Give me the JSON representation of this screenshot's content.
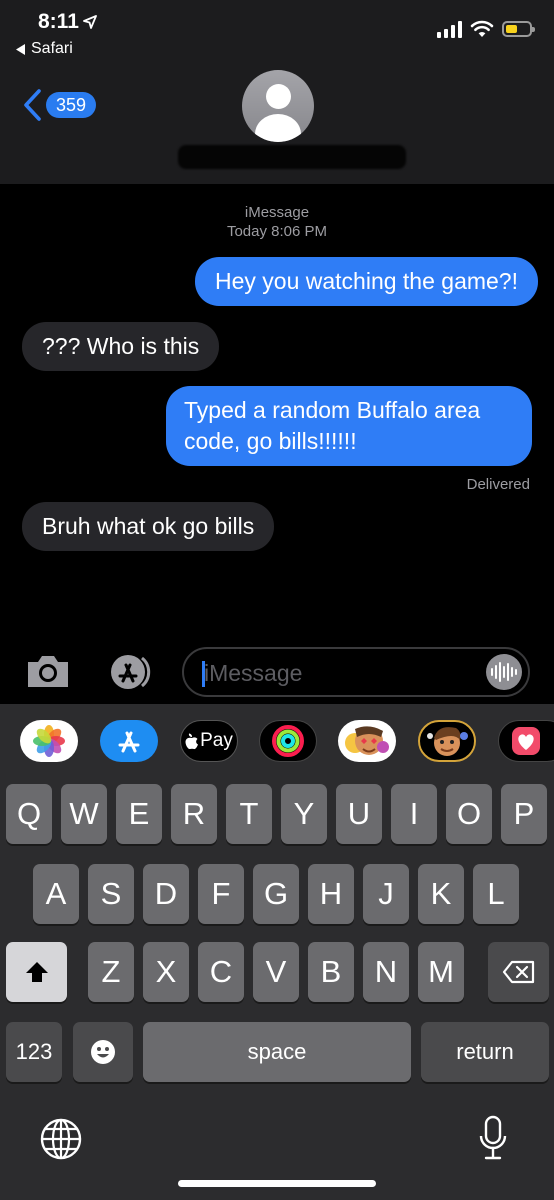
{
  "status_bar": {
    "time": "8:11",
    "back_app": "Safari"
  },
  "header": {
    "back_count": "359"
  },
  "thread": {
    "service": "iMessage",
    "timestamp": "Today 8:06 PM",
    "messages": [
      {
        "from": "me",
        "text": "Hey you watching the game?!"
      },
      {
        "from": "them",
        "text": "??? Who is this"
      },
      {
        "from": "me",
        "text": "Typed a random Buffalo area code, go bills!!!!!!"
      },
      {
        "from": "them",
        "text": "Bruh what ok go bills"
      }
    ],
    "delivery_status": "Delivered"
  },
  "input": {
    "placeholder": "iMessage"
  },
  "app_strip": {
    "apps": [
      "photos-icon",
      "app-store-icon",
      "apple-pay-icon",
      "activity-icon",
      "memoji-stickers-icon",
      "memoji-icon",
      "digital-touch-icon"
    ],
    "apple_pay_label": "Pay"
  },
  "keyboard": {
    "row1": [
      "Q",
      "W",
      "E",
      "R",
      "T",
      "Y",
      "U",
      "I",
      "O",
      "P"
    ],
    "row2": [
      "A",
      "S",
      "D",
      "F",
      "G",
      "H",
      "J",
      "K",
      "L"
    ],
    "row3": [
      "Z",
      "X",
      "C",
      "V",
      "B",
      "N",
      "M"
    ],
    "numbers_label": "123",
    "space_label": "space",
    "return_label": "return"
  }
}
